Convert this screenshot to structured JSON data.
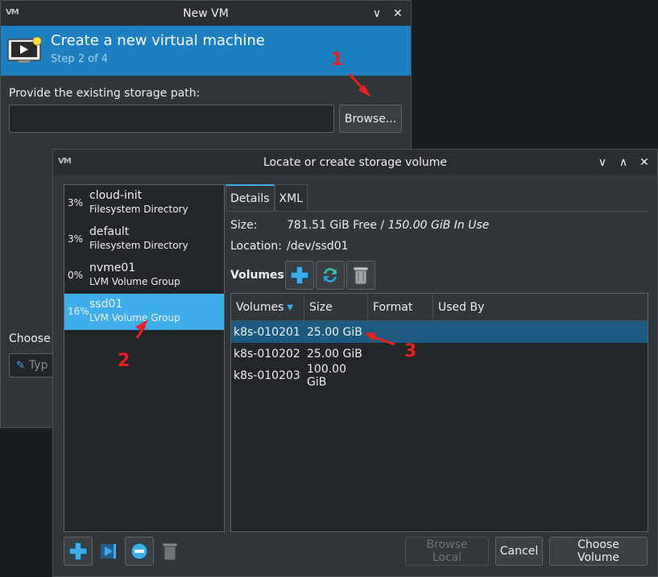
{
  "back_window": {
    "title": "New VM",
    "header_title": "Create a new virtual machine",
    "header_step": "Step 2 of 4",
    "storage_label": "Provide the existing storage path:",
    "storage_path_value": "",
    "browse_label": "Browse...",
    "choose_label": "Choose",
    "type_placeholder": "Typ",
    "controls": {
      "minimize": "∨",
      "close": "✕"
    }
  },
  "front_window": {
    "title": "Locate or create storage volume",
    "controls": {
      "minimize": "∨",
      "maximize": "∧",
      "close": "✕"
    },
    "pools": [
      {
        "pct": "3%",
        "name": "cloud-init",
        "type": "Filesystem Directory"
      },
      {
        "pct": "3%",
        "name": "default",
        "type": "Filesystem Directory"
      },
      {
        "pct": "0%",
        "name": "nvme01",
        "type": "LVM Volume Group"
      },
      {
        "pct": "16%",
        "name": "ssd01",
        "type": "LVM Volume Group"
      }
    ],
    "selected_pool": 3,
    "tabs": [
      {
        "label": "Details"
      },
      {
        "label": "XML"
      }
    ],
    "size_label": "Size:",
    "size_free": "781.51 GiB Free",
    "size_sep": " / ",
    "size_inuse": "150.00 GiB In Use",
    "location_label": "Location:",
    "location_value": "/dev/ssd01",
    "volumes_label": "Volumes",
    "columns": [
      "Volumes",
      "Size",
      "Format",
      "Used By"
    ],
    "volumes": [
      {
        "name": "k8s-010201",
        "size": "25.00 GiB",
        "format": "",
        "used_by": ""
      },
      {
        "name": "k8s-010202",
        "size": "25.00 GiB",
        "format": "",
        "used_by": ""
      },
      {
        "name": "k8s-010203",
        "size": "100.00 GiB",
        "format": "",
        "used_by": ""
      }
    ],
    "selected_volume": 0,
    "buttons": {
      "browse_local": "Browse Local",
      "cancel": "Cancel",
      "choose_volume": "Choose Volume"
    }
  },
  "annotations": [
    "1",
    "2",
    "3"
  ],
  "colors": {
    "accent": "#3daee9",
    "header_banner": "#1d7fbf",
    "annotation": "#e8211f",
    "selected_row": "#1e5a80"
  }
}
